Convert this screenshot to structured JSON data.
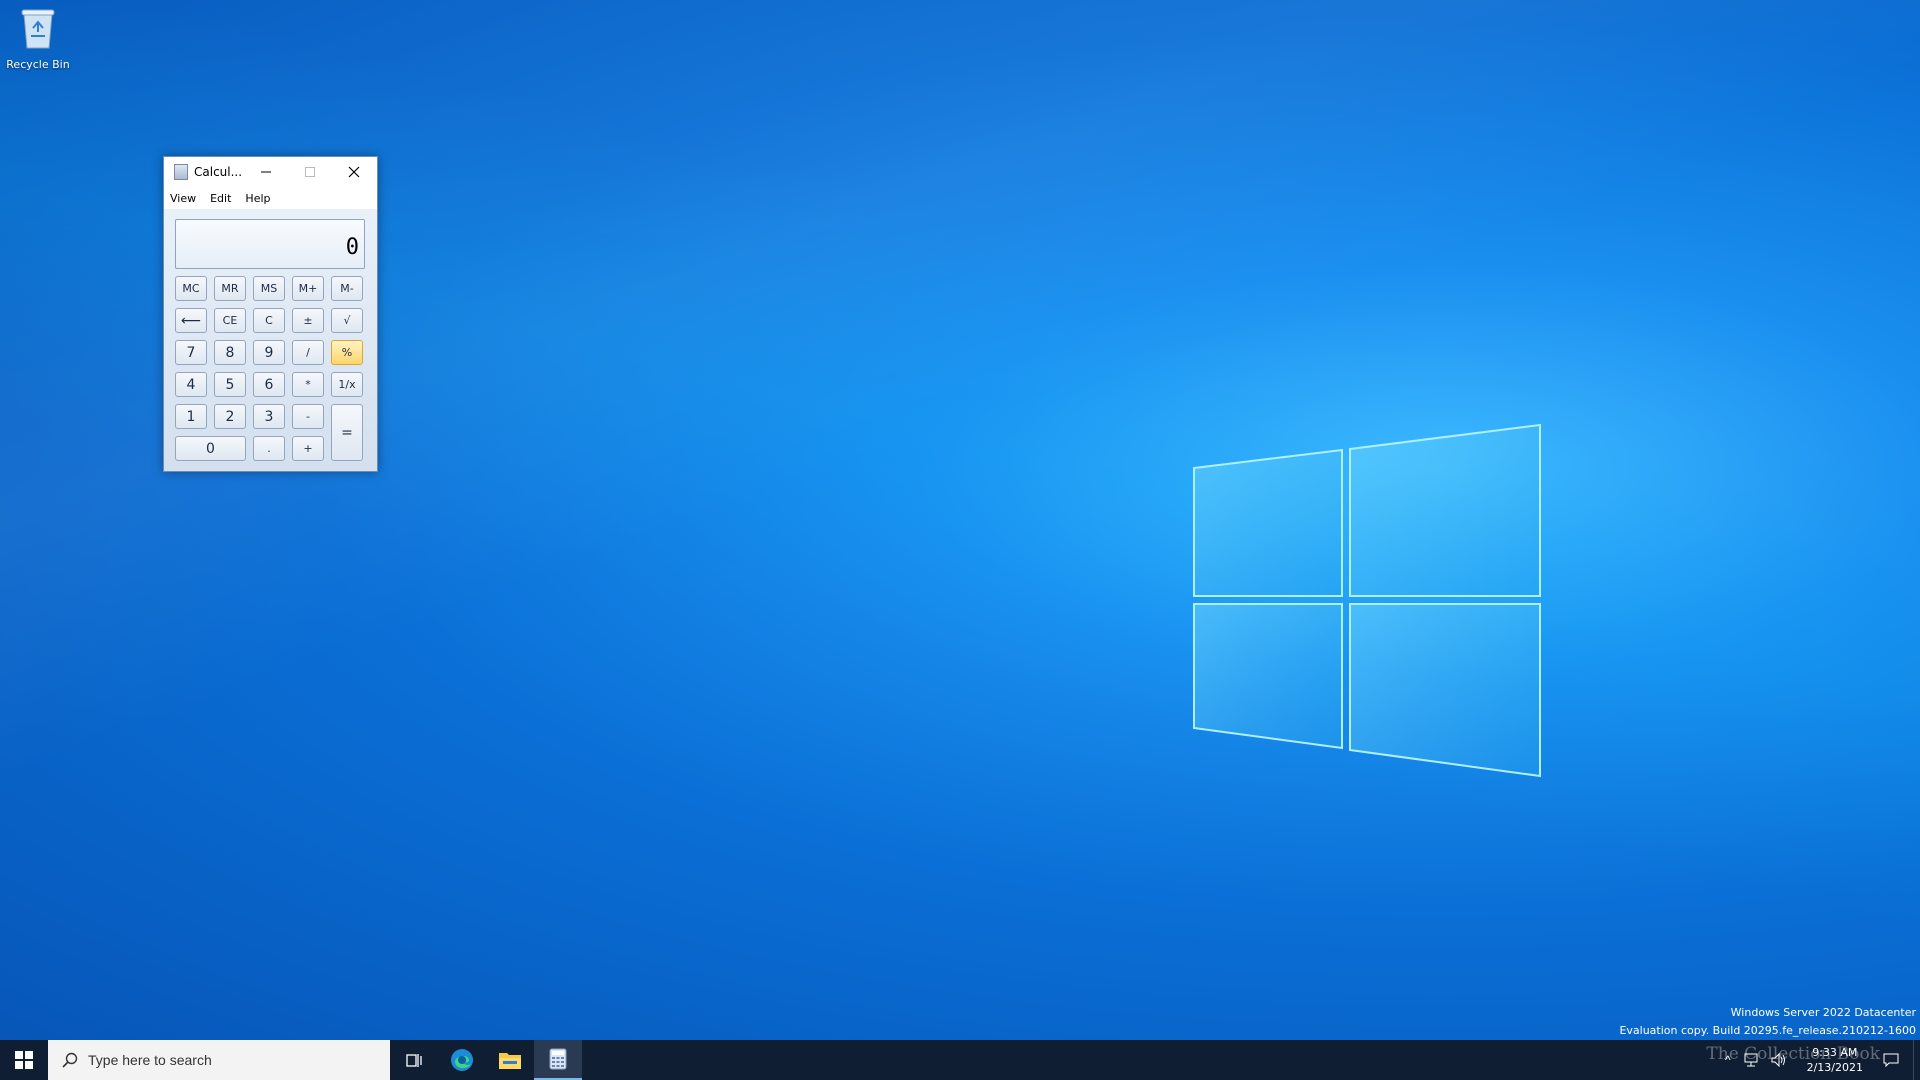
{
  "desktop": {
    "icons": [
      {
        "label": "Recycle Bin",
        "icon": "recycle-bin-icon"
      }
    ],
    "watermark": {
      "line1": "Windows Server 2022 Datacenter",
      "line2": "Evaluation copy. Build 20295.fe_release.210212-1600"
    }
  },
  "calculator": {
    "title": "Calcul...",
    "menu": [
      "View",
      "Edit",
      "Help"
    ],
    "display": "0",
    "keys": {
      "mc": "MC",
      "mr": "MR",
      "ms": "MS",
      "mplus": "M+",
      "mminus": "M-",
      "back": "⟵",
      "ce": "CE",
      "c": "C",
      "plusminus": "±",
      "sqrt": "√",
      "k7": "7",
      "k8": "8",
      "k9": "9",
      "div": "/",
      "pct": "%",
      "k4": "4",
      "k5": "5",
      "k6": "6",
      "mul": "*",
      "recip": "1/x",
      "k1": "1",
      "k2": "2",
      "k3": "3",
      "sub": "-",
      "eq": "=",
      "k0": "0",
      "dot": ".",
      "add": "+"
    }
  },
  "taskbar": {
    "search_placeholder": "Type here to search",
    "apps": [
      "task-view-icon",
      "edge-icon",
      "file-explorer-icon",
      "calculator-icon"
    ],
    "clock": {
      "time": "9:33 AM",
      "date": "2/13/2021"
    },
    "overlay": "The Collection Book"
  },
  "colors": {
    "accent": "#0a6fd6",
    "taskbar": "#0f1e32",
    "highlight_key": "#ffd56a"
  }
}
